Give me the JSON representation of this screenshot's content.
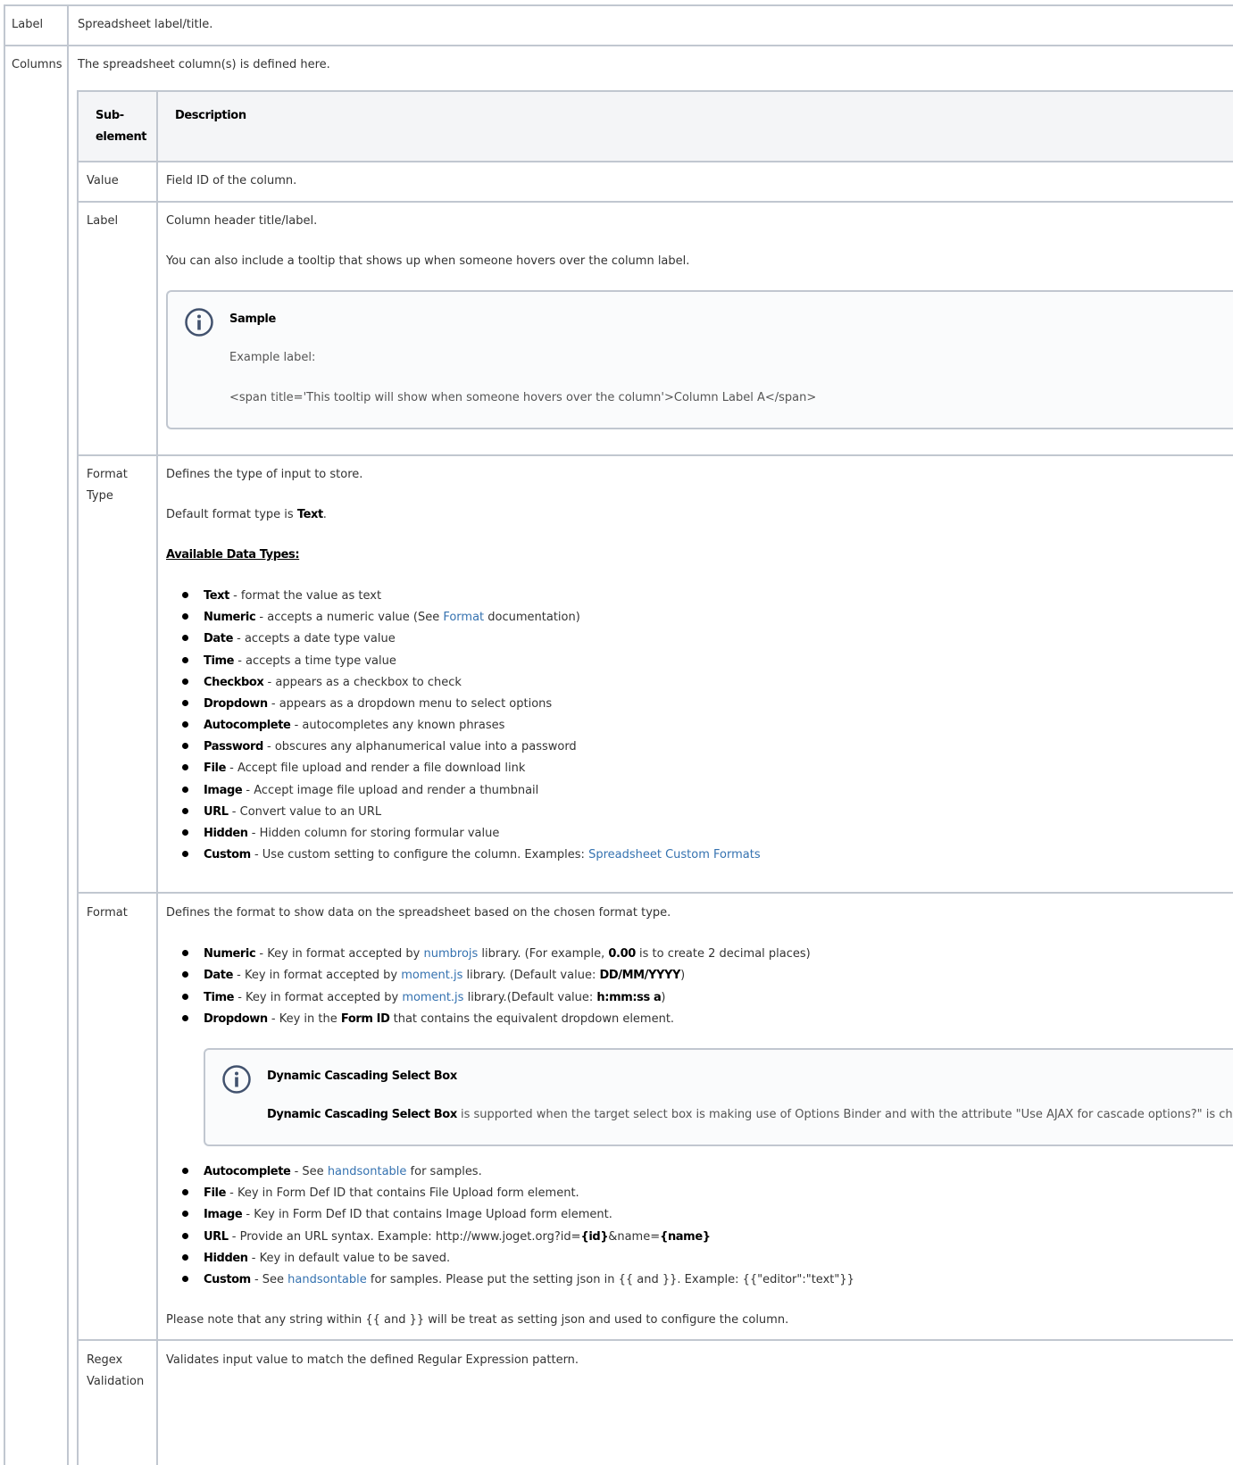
{
  "outer_rows": {
    "label": {
      "name": "Label",
      "desc": "Spreadsheet label/title."
    },
    "columns": {
      "name": "Columns",
      "desc": "The spreadsheet column(s) is defined here."
    }
  },
  "inner_header": {
    "sub_element": "Sub-element",
    "sub_element_l1": "Sub-",
    "sub_element_l2": "element",
    "description": "Description"
  },
  "value_row": {
    "name": "Value",
    "desc": "Field ID of the column."
  },
  "label_row": {
    "name": "Label",
    "desc1": "Column header title/label.",
    "desc2": "You can also include a tooltip that shows up when someone hovers over the column label.",
    "panel": {
      "icon": "info-icon",
      "title": "Sample",
      "line1": "Example label:",
      "line2": "<span title='This tooltip will show when someone hovers over the column'>Column Label A</span>"
    }
  },
  "format_type_row": {
    "name_l1": "Format",
    "name_l2": "Type",
    "desc1": "Defines the type of input to store.",
    "desc2_pre": "Default format type is ",
    "desc2_bold": "Text",
    "desc2_post": ".",
    "types_title": "Available Data Types:",
    "types": [
      {
        "name": "Text",
        "desc": " - format the value as text"
      },
      {
        "name": "Numeric",
        "desc": " - accepts a numeric value (See ",
        "link": "Format",
        "desc_post": " documentation)"
      },
      {
        "name": "Date",
        "desc": " - accepts a date type value"
      },
      {
        "name": "Time",
        "desc": " - accepts a time type value"
      },
      {
        "name": "Checkbox",
        "desc": " - appears as a checkbox to check"
      },
      {
        "name": "Dropdown",
        "desc": " - appears as a dropdown menu to select options"
      },
      {
        "name": "Autocomplete",
        "desc": " - autocompletes any known phrases"
      },
      {
        "name": "Password",
        "desc": " - obscures any alphanumerical value into a password"
      },
      {
        "name": "File",
        "desc": " - Accept file upload and render a file download link"
      },
      {
        "name": "Image",
        "desc": " - Accept image file upload and render a thumbnail"
      },
      {
        "name": "URL",
        "desc": " - Convert value to an URL"
      },
      {
        "name": "Hidden",
        "desc": " - Hidden column for storing formular value"
      },
      {
        "name": "Custom",
        "desc": " - Use custom setting to configure the column. Examples: ",
        "link": "Spreadsheet Custom Formats"
      }
    ]
  },
  "format_row": {
    "name": "Format",
    "desc": "Defines the format to show data on the spreadsheet based on the chosen format type.",
    "items_a": [
      {
        "name": "Numeric",
        "p1": " - Key in format accepted by ",
        "link": "numbrojs",
        "p2": " library. (For example, ",
        "bold": "0.00",
        "p3": " is to create 2 decimal places)"
      },
      {
        "name": "Date",
        "p1": " - Key in format accepted by ",
        "link": "moment.js",
        "p2": " library. (Default value: ",
        "bold": "DD/MM/YYYY",
        "p3": ")"
      },
      {
        "name": "Time",
        "p1": " - Key in format accepted by ",
        "link": "moment.js",
        "p2": " library.(Default value: ",
        "bold": "h:mm:ss a",
        "p3": ")"
      },
      {
        "name": "Dropdown",
        "p1": " - Key in the ",
        "bold": "Form ID",
        "p2": " that contains the equivalent dropdown element."
      }
    ],
    "panel": {
      "icon": "info-icon",
      "title": "Dynamic Cascading Select Box",
      "bold": "Dynamic Cascading Select Box",
      "text": " is supported when the target select box is making use of Options Binder and with the attribute \"Use AJAX for cascade options?\" is checked."
    },
    "items_b": [
      {
        "name": "Autocomplete",
        "p1": " - See ",
        "link": "handsontable",
        "p2": " for samples."
      },
      {
        "name": "File",
        "p1": " - Key in Form Def ID that contains File Upload form element."
      },
      {
        "name": "Image",
        "p1": " - Key in Form Def ID that contains Image Upload form element."
      },
      {
        "name": "URL",
        "p1": " - Provide an URL syntax. Example: http://www.joget.org?id=",
        "bold": "{id}",
        "p2": "&name=",
        "bold2": "{name}"
      },
      {
        "name": "Hidden",
        "p1": " - Key in default value to be saved."
      },
      {
        "name": "Custom",
        "p1": " - See ",
        "link": "handsontable",
        "p2": " for samples. Please put the setting json in {{ and }}. Example: {{\"editor\":\"text\"}}"
      }
    ],
    "note": "Please note that any string within {{ and }} will be treat as setting json and used to configure the column."
  },
  "regex_row": {
    "name_l1": "Regex",
    "name_l2": "Validation",
    "desc": "Validates input value to match the defined Regular Expression pattern."
  },
  "colors": {
    "border": "#c1c7d0",
    "header_bg": "#f4f5f7",
    "link": "#3572b0",
    "panel_bg": "#fafbfc"
  }
}
